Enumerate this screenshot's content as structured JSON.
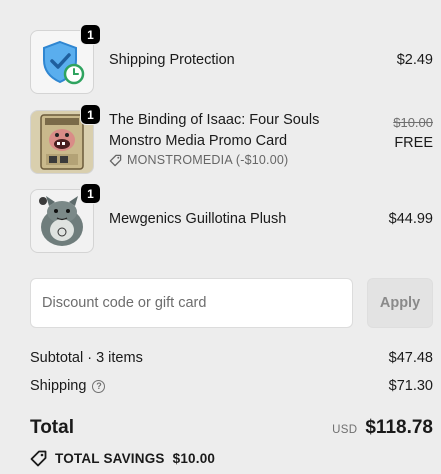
{
  "items": [
    {
      "quantity": "1",
      "name": "Shipping Protection",
      "price": "$2.49",
      "image": "shield-clock-icon"
    },
    {
      "quantity": "1",
      "name": "The Binding of Isaac: Four Souls Monstro Media Promo Card",
      "original_price": "$10.00",
      "price": "FREE",
      "discount_code": "MONSTROMEDIA (-$10.00)",
      "image": "monstro-card-image"
    },
    {
      "quantity": "1",
      "name": "Mewgenics Guillotina Plush",
      "price": "$44.99",
      "image": "plush-cat-image"
    }
  ],
  "discount": {
    "placeholder": "Discount code or gift card",
    "value": "",
    "apply_label": "Apply"
  },
  "summary": {
    "subtotal_label": "Subtotal · 3 items",
    "subtotal_value": "$47.48",
    "shipping_label": "Shipping",
    "shipping_value": "$71.30",
    "total_label": "Total",
    "currency": "USD",
    "total_value": "$118.78",
    "savings_label": "TOTAL SAVINGS",
    "savings_value": "$10.00"
  },
  "colors": {
    "background": "#ededed",
    "shield": "#4a9ee0",
    "clock": "#3cb371"
  }
}
